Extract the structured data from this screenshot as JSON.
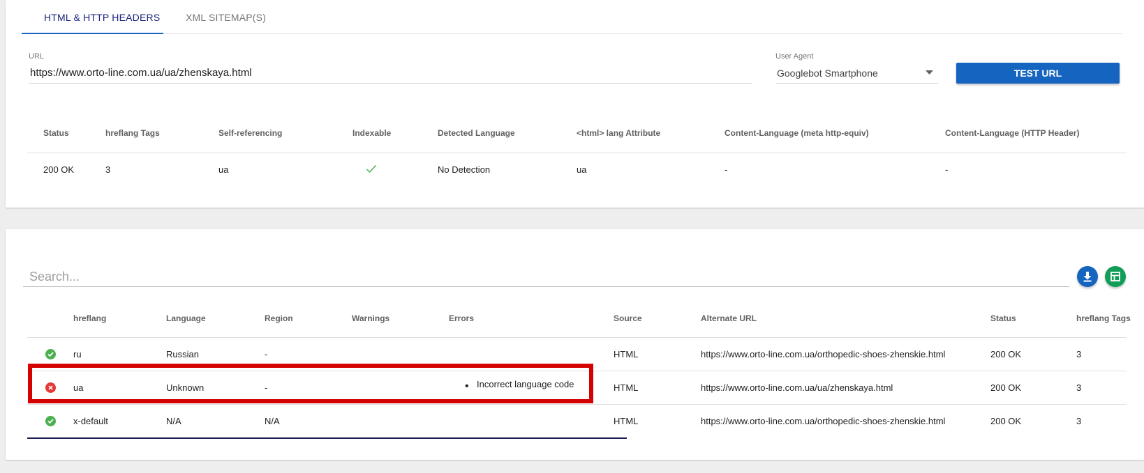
{
  "tabs": [
    {
      "label": "HTML & HTTP HEADERS",
      "active": true
    },
    {
      "label": "XML SITEMAP(S)",
      "active": false
    }
  ],
  "url_field": {
    "label": "URL",
    "value": "https://www.orto-line.com.ua/ua/zhenskaya.html"
  },
  "user_agent": {
    "label": "User Agent",
    "value": "Googlebot Smartphone",
    "icon": "dropdown-arrow-icon"
  },
  "test_button": {
    "label": "TEST URL"
  },
  "summary": {
    "headers": [
      "Status",
      "hreflang Tags",
      "Self-referencing",
      "Indexable",
      "Detected Language",
      "<html> lang Attribute",
      "Content-Language (meta http-equiv)",
      "Content-Language (HTTP Header)"
    ],
    "row": {
      "status": "200 OK",
      "hreflang_tags": "3",
      "self_referencing": "ua",
      "indexable_icon": "checkmark-icon",
      "detected_language": "No Detection",
      "html_lang": "ua",
      "content_language_meta": "-",
      "content_language_header": "-"
    }
  },
  "search": {
    "placeholder": "Search..."
  },
  "actions": [
    {
      "name": "download-button",
      "icon": "download-icon",
      "color": "#1565c0"
    },
    {
      "name": "sheets-export-button",
      "icon": "spreadsheet-icon",
      "color": "#0f9d58"
    }
  ],
  "hreflang_table": {
    "headers": [
      "hreflang",
      "Language",
      "Region",
      "Warnings",
      "Errors",
      "Source",
      "Alternate URL",
      "Status",
      "hreflang Tags"
    ],
    "rows": [
      {
        "state": "ok",
        "hreflang": "ru",
        "language": "Russian",
        "region": "-",
        "warnings": "",
        "errors": "",
        "source": "HTML",
        "alternate_url": "https://www.orto-line.com.ua/orthopedic-shoes-zhenskie.html",
        "status": "200 OK",
        "tags": "3"
      },
      {
        "state": "error",
        "hreflang": "ua",
        "language": "Unknown",
        "region": "-",
        "warnings": "",
        "errors": "Incorrect language code",
        "source": "HTML",
        "alternate_url": "https://www.orto-line.com.ua/ua/zhenskaya.html",
        "status": "200 OK",
        "tags": "3"
      },
      {
        "state": "ok",
        "hreflang": "x-default",
        "language": "N/A",
        "region": "N/A",
        "warnings": "",
        "errors": "",
        "source": "HTML",
        "alternate_url": "https://www.orto-line.com.ua/orthopedic-shoes-zhenskie.html",
        "status": "200 OK",
        "tags": "3"
      }
    ]
  },
  "colors": {
    "ok": "#4caf50",
    "error": "#e53935",
    "highlight": "#d50000",
    "primary": "#1565c0",
    "tab_active": "#1a237e"
  }
}
